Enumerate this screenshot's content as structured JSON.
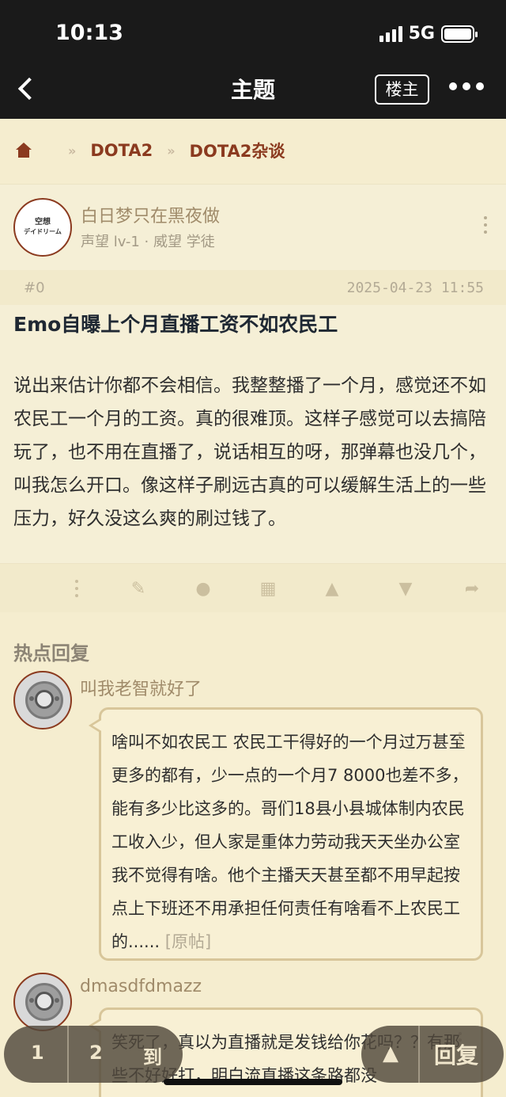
{
  "status": {
    "time": "10:13",
    "network": "5G"
  },
  "nav": {
    "title": "主题",
    "owner_button": "楼主"
  },
  "breadcrumb": {
    "items": [
      "DOTA2",
      "DOTA2杂谈"
    ]
  },
  "post": {
    "avatar_text_1": "空想",
    "avatar_text_2": "デイドリーム",
    "author": "白日梦只在黑夜做",
    "meta": "声望 lv-1 · 威望 学徒",
    "floor": "#0",
    "time": "2025-04-23 11:55",
    "title": "Emo自曝上个月直播工资不如农民工",
    "body": "说出来估计你都不会相信。我整整播了一个月，感觉还不如农民工一个月的工资。真的很难顶。这样子感觉可以去搞陪玩了，也不用在直播了，说话相互的呀，那弹幕也没几个，叫我怎么开口。像这样子刷远古真的可以缓解生活上的一些压力，好久没这么爽的刷过钱了。"
  },
  "hot_replies": {
    "title": "热点回复",
    "items": [
      {
        "author": "叫我老智就好了",
        "text": "啥叫不如农民工 农民工干得好的一个月过万甚至更多的都有，少一点的一个月7 8000也差不多，能有多少比这多的。哥们18县小县城体制内农民工收入少，但人家是重体力劳动我天天坐办公室我不觉得有啥。他个主播天天甚至都不用早起按点上下班还不用承担任何责任有啥看不上农民工的......",
        "link": "[原帖]"
      },
      {
        "author": "dmasdfdmazz",
        "text": "笑死了，真以为直播就是发钱给你花吗？？有那些不好好打，明白流直播这条路都没"
      }
    ]
  },
  "pager": {
    "page1": "1",
    "page2": "2",
    "goto": "到"
  },
  "reply_bar": {
    "label": "回复"
  }
}
